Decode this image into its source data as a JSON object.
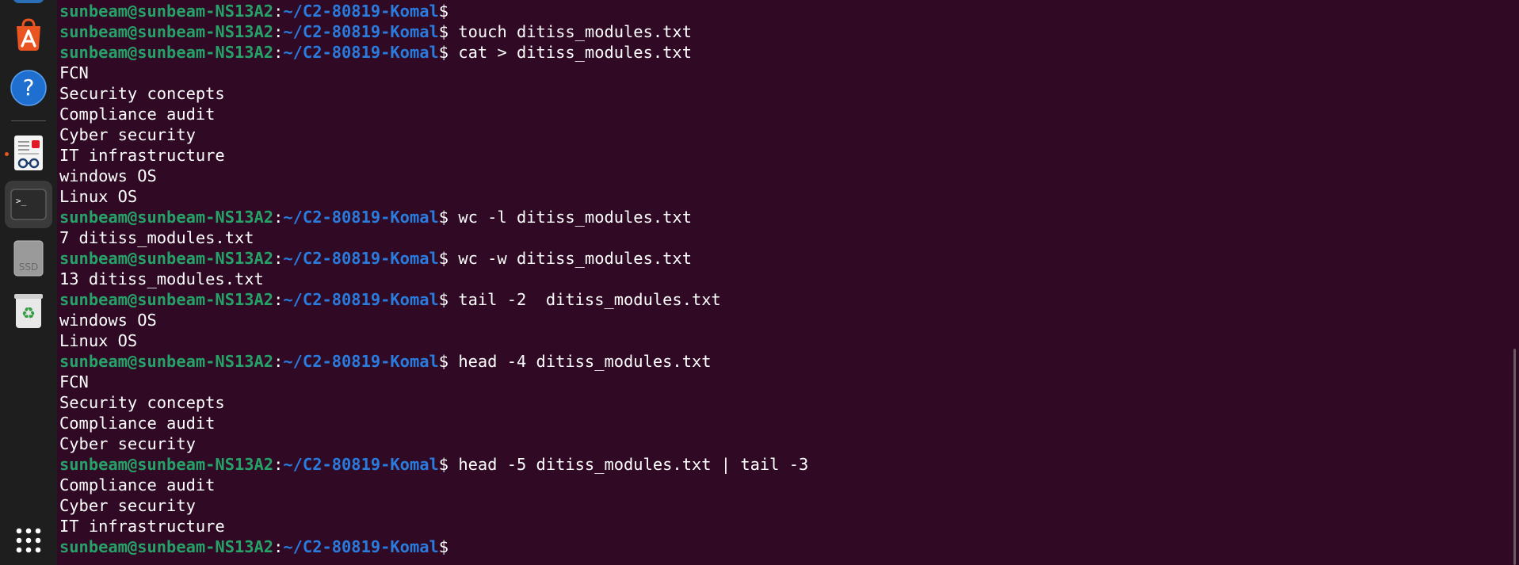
{
  "dock": {
    "items": [
      {
        "name": "app-center-icon",
        "label": "App Center"
      },
      {
        "name": "help-icon",
        "label": "?"
      },
      {
        "name": "document-viewer-icon",
        "label": ""
      },
      {
        "name": "terminal-icon",
        "label": ">_"
      },
      {
        "name": "ssd-drive-icon",
        "label": "SSD"
      },
      {
        "name": "trash-icon",
        "label": "♻"
      },
      {
        "name": "show-apps-icon",
        "label": ""
      }
    ],
    "colors": {
      "accent": "#e95420",
      "help": "#1e6fd0",
      "terminal_bg": "#2b2b2b"
    }
  },
  "terminal": {
    "prompt": {
      "user_host": "sunbeam@sunbeam-NS13A2",
      "colon": ":",
      "path": "~/C2-80819-Komal",
      "dollar": "$"
    },
    "lines": [
      {
        "type": "prompt",
        "cmd": ""
      },
      {
        "type": "prompt",
        "cmd": " touch ditiss_modules.txt"
      },
      {
        "type": "prompt",
        "cmd": " cat > ditiss_modules.txt"
      },
      {
        "type": "output",
        "text": "FCN"
      },
      {
        "type": "output",
        "text": "Security concepts"
      },
      {
        "type": "output",
        "text": "Compliance audit"
      },
      {
        "type": "output",
        "text": "Cyber security"
      },
      {
        "type": "output",
        "text": "IT infrastructure"
      },
      {
        "type": "output",
        "text": "windows OS"
      },
      {
        "type": "output",
        "text": "Linux OS"
      },
      {
        "type": "prompt",
        "cmd": " wc -l ditiss_modules.txt"
      },
      {
        "type": "output",
        "text": "7 ditiss_modules.txt"
      },
      {
        "type": "prompt",
        "cmd": " wc -w ditiss_modules.txt"
      },
      {
        "type": "output",
        "text": "13 ditiss_modules.txt"
      },
      {
        "type": "prompt",
        "cmd": " tail -2  ditiss_modules.txt"
      },
      {
        "type": "output",
        "text": "windows OS"
      },
      {
        "type": "output",
        "text": "Linux OS"
      },
      {
        "type": "prompt",
        "cmd": " head -4 ditiss_modules.txt"
      },
      {
        "type": "output",
        "text": "FCN"
      },
      {
        "type": "output",
        "text": "Security concepts"
      },
      {
        "type": "output",
        "text": "Compliance audit"
      },
      {
        "type": "output",
        "text": "Cyber security"
      },
      {
        "type": "prompt",
        "cmd": " head -5 ditiss_modules.txt | tail -3"
      },
      {
        "type": "output",
        "text": "Compliance audit"
      },
      {
        "type": "output",
        "text": "Cyber security"
      },
      {
        "type": "output",
        "text": "IT infrastructure"
      },
      {
        "type": "prompt",
        "cmd": " "
      }
    ],
    "colors": {
      "background": "#300a24",
      "user_host": "#26a269",
      "path": "#2a7bde",
      "text": "#ffffff"
    }
  }
}
